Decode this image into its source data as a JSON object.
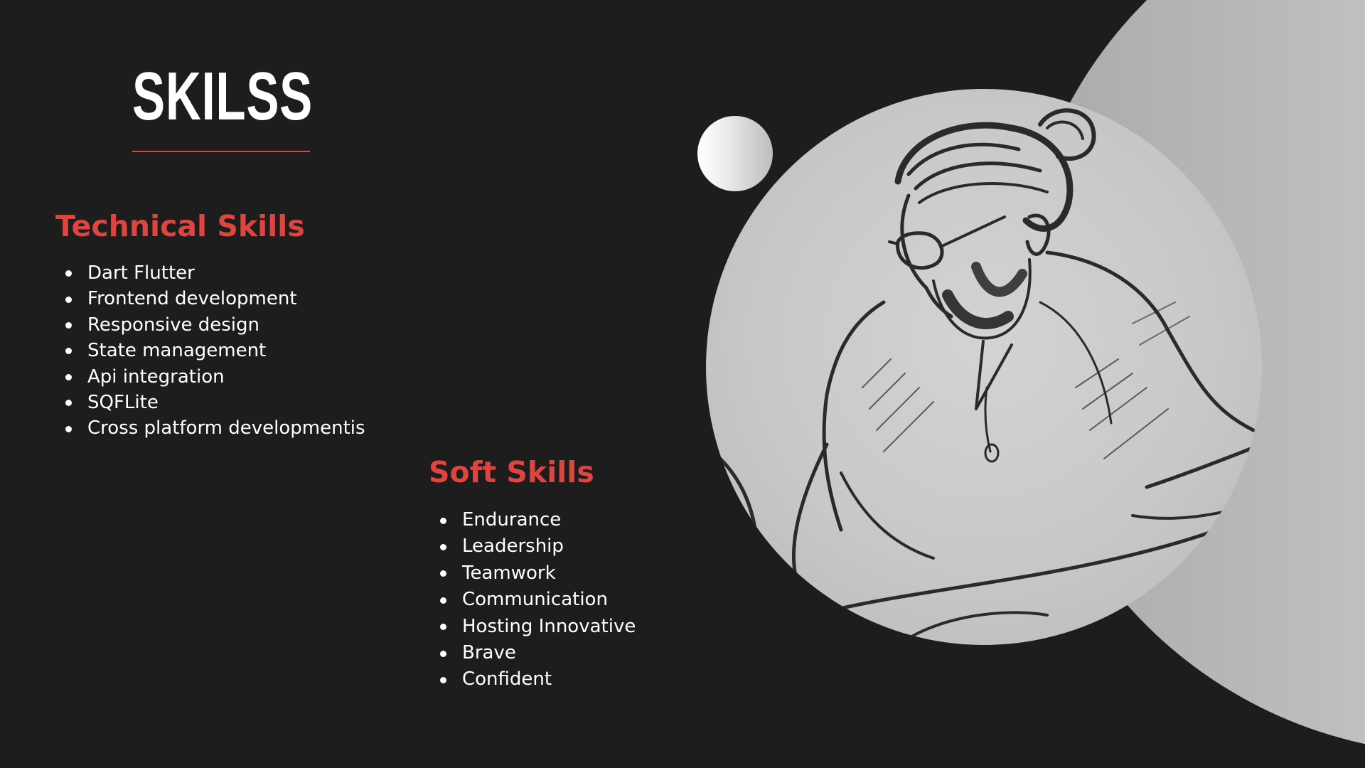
{
  "title": "SKILSS",
  "accent_color": "#e0443e",
  "background_color": "#1d1d1d",
  "technical": {
    "heading": "Technical Skills",
    "items": [
      "Dart Flutter",
      " Frontend development",
      " Responsive design",
      " State management",
      "Api integration",
      " SQFLite",
      " Cross platform developmentis"
    ]
  },
  "soft": {
    "heading": "Soft Skills",
    "items": [
      "Endurance",
      " Leadership",
      " Teamwork",
      "Communication",
      " Hosting Innovative",
      " Brave",
      " Confident"
    ]
  },
  "image": {
    "subject": "pencil sketch portrait of a bearded man with glasses"
  }
}
